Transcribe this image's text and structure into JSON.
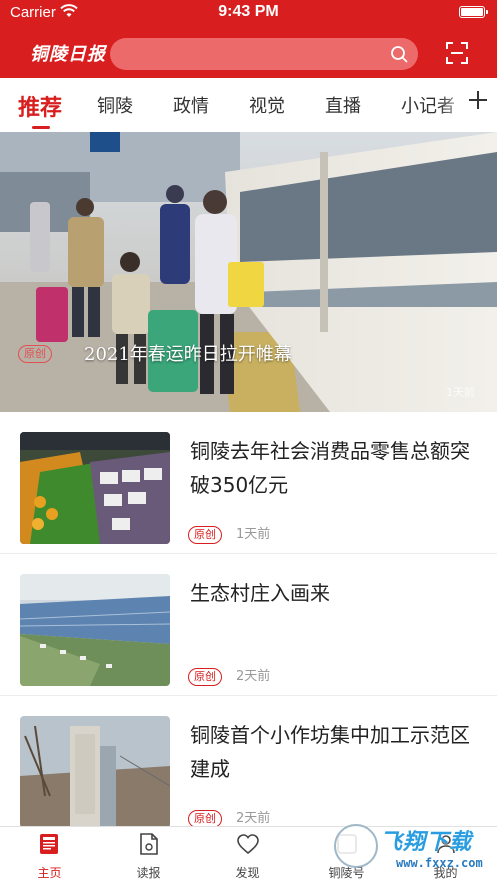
{
  "status": {
    "carrier": "Carrier",
    "time": "9:43 PM"
  },
  "header": {
    "logo": "铜陵日报",
    "search_placeholder": ""
  },
  "tabs": [
    {
      "label": "推荐",
      "active": true
    },
    {
      "label": "铜陵"
    },
    {
      "label": "政情"
    },
    {
      "label": "视觉"
    },
    {
      "label": "直播"
    },
    {
      "label": "小记者"
    }
  ],
  "hero": {
    "badge": "原创",
    "title": "2021年春运昨日拉开帷幕",
    "watermark": "1天前"
  },
  "news": [
    {
      "title": "铜陵去年社会消费品零售总额突破350亿元",
      "badge": "原创",
      "time": "1天前"
    },
    {
      "title": "生态村庄入画来",
      "badge": "原创",
      "time": "2天前"
    },
    {
      "title": "铜陵首个小作坊集中加工示范区建成",
      "badge": "原创",
      "time": "2天前"
    }
  ],
  "bottom_nav": [
    {
      "label": "主页",
      "icon": "news-icon",
      "active": true
    },
    {
      "label": "读报",
      "icon": "newspaper-icon"
    },
    {
      "label": "发现",
      "icon": "heart-icon"
    },
    {
      "label": "铜陵号",
      "icon": "profile-icon"
    },
    {
      "label": "我的",
      "icon": "user-icon"
    }
  ],
  "site_watermark": {
    "name": "飞翔下载",
    "url": "www.fxxz.com"
  },
  "colors": {
    "brand_red": "#d81e1e",
    "search_bg": "#ec6a6a"
  }
}
